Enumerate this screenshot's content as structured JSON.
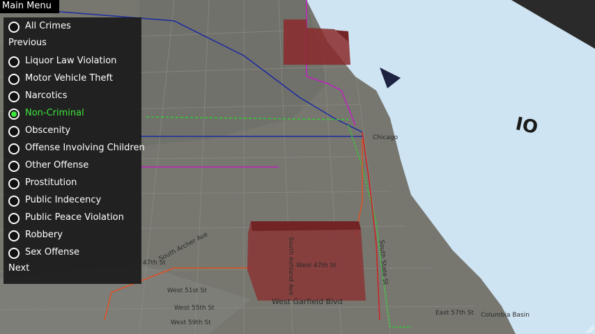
{
  "menu": {
    "title": "Main Menu"
  },
  "crime_list": {
    "all_label": "All Crimes",
    "previous_label": "Previous",
    "next_label": "Next",
    "items": [
      {
        "label": "Liquor Law Violation",
        "selected": false
      },
      {
        "label": "Motor Vehicle Theft",
        "selected": false
      },
      {
        "label": "Narcotics",
        "selected": false
      },
      {
        "label": "Non-Criminal",
        "selected": true
      },
      {
        "label": "Obscenity",
        "selected": false
      },
      {
        "label": "Offense Involving Children",
        "selected": false
      },
      {
        "label": "Other Offense",
        "selected": false
      },
      {
        "label": "Prostitution",
        "selected": false
      },
      {
        "label": "Public Indecency",
        "selected": false
      },
      {
        "label": "Public Peace Violation",
        "selected": false
      },
      {
        "label": "Robbery",
        "selected": false
      },
      {
        "label": "Sex Offense",
        "selected": false
      }
    ]
  },
  "map": {
    "street_labels": [
      "South Archer Ave",
      "South Ashland Ave",
      "West 47th St",
      "West 51st St",
      "West 55th St",
      "West 59th St",
      "West Garfield Blvd",
      "47th St",
      "South State St",
      "East 57th St",
      "Columbia Basin",
      "Chicago"
    ],
    "lake_label": "IO",
    "colors": {
      "lake": "#cfe4f3",
      "land": "#7b7b74",
      "crime_column": "#8a2a2a",
      "selected": "#3ce63c"
    }
  }
}
